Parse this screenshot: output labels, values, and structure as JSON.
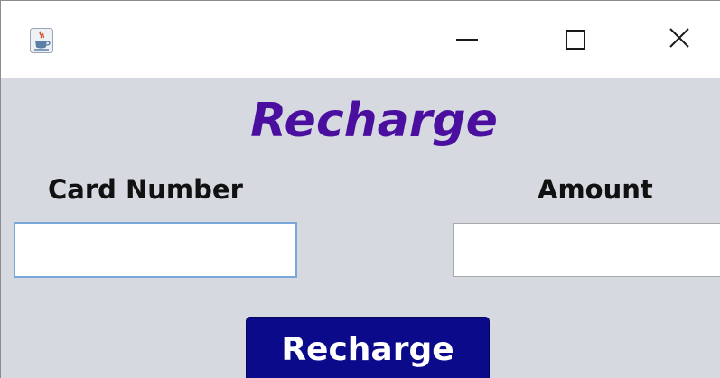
{
  "window": {
    "icon": "java-cup-icon",
    "controls": {
      "minimize_icon": "minimize-icon",
      "maximize_icon": "maximize-icon",
      "close_icon": "close-icon"
    }
  },
  "form": {
    "heading": "Recharge",
    "card_number_label": "Card Number",
    "card_number_value": "",
    "amount_label": "Amount",
    "amount_value": "",
    "submit_label": "Recharge"
  },
  "colors": {
    "heading": "#4b0fa0",
    "background": "#d6d9e0",
    "button": "#0a0a8a",
    "focus_border": "#7aa7d9"
  }
}
